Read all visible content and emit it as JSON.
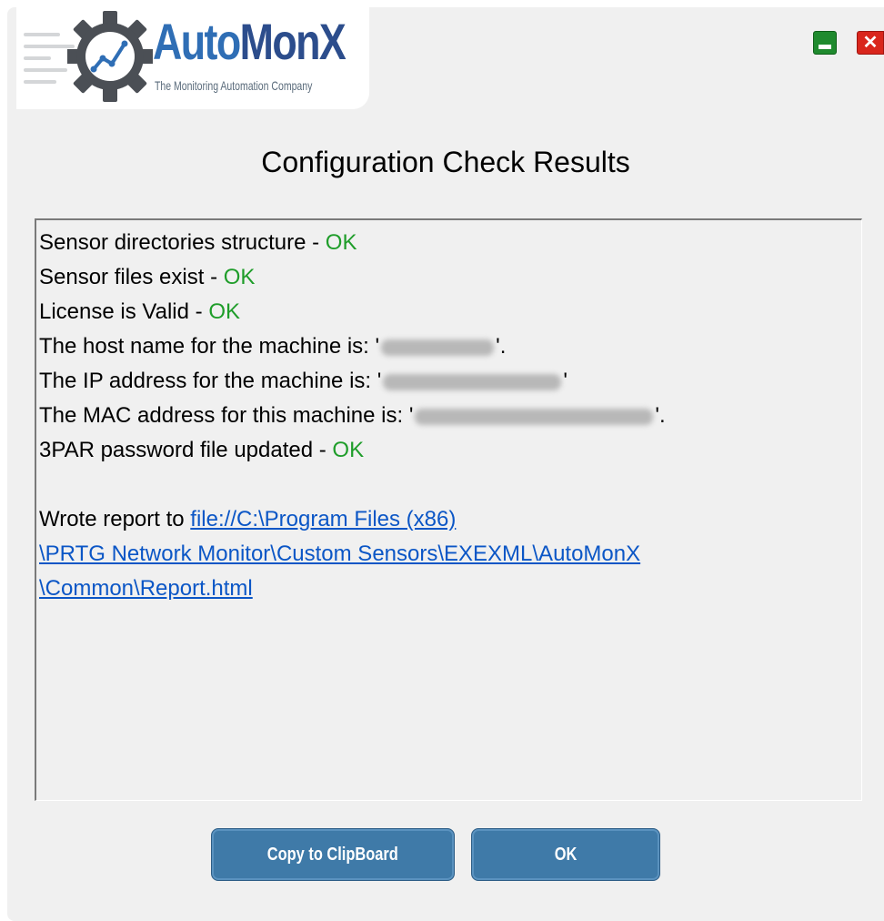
{
  "logo": {
    "title_a": "Auto",
    "title_b": "MonX",
    "tagline": "The Monitoring Automation Company"
  },
  "window_buttons": {
    "minimize_icon": "minimize-icon",
    "close_icon": "close-icon",
    "close_glyph": "✕"
  },
  "title": "Configuration Check Results",
  "results": {
    "dir_structure": "Sensor directories structure - ",
    "files_exist": "Sensor files exist - ",
    "license": "License is Valid - ",
    "ok": "OK",
    "host_prefix": "The host name for the machine is: '",
    "host_suffix": "'.",
    "ip_prefix": "The IP address for the machine is: '",
    "ip_suffix": "'",
    "mac_prefix": "The MAC address for this machine is: '",
    "mac_suffix": "'.",
    "threepar": "3PAR password file updated - ",
    "report_prefix": "Wrote report to ",
    "report_link_1": "file://C:\\Program Files (x86)",
    "report_link_2": "\\PRTG Network Monitor\\Custom Sensors\\EXEXML\\AutoMonX",
    "report_link_3": "\\Common\\Report.html"
  },
  "buttons": {
    "copy": "Copy to ClipBoard",
    "ok": "OK"
  },
  "colors": {
    "ok_green": "#1f9d2a",
    "link_blue": "#0b56c6",
    "button_blue": "#3f7aa8",
    "minimize_green": "#1f8a2e",
    "close_red": "#d9261c"
  }
}
